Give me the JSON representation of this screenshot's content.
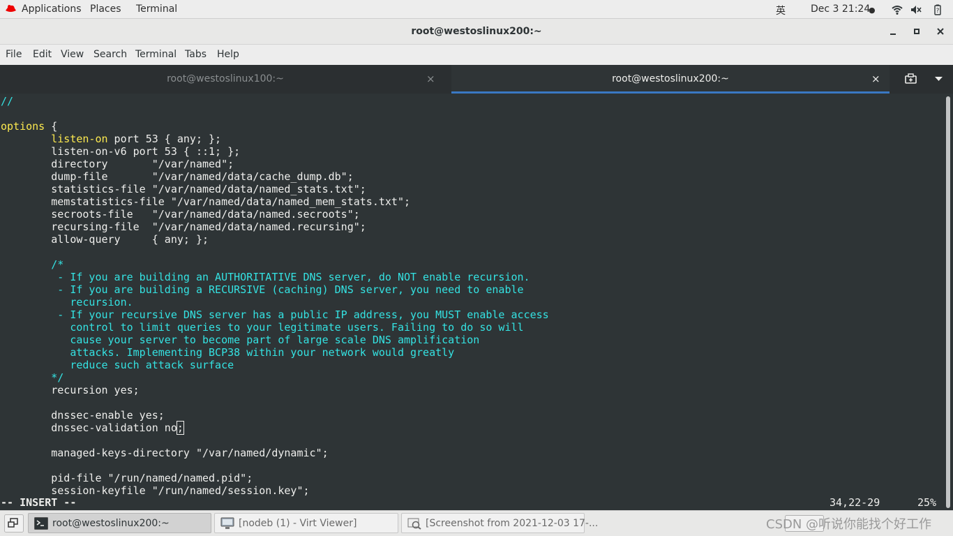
{
  "topbar": {
    "applications": "Applications",
    "places": "Places",
    "terminal": "Terminal",
    "ime": "英",
    "datetime": "Dec 3  21:24",
    "dot": "●"
  },
  "window": {
    "title": "root@westoslinux200:~"
  },
  "menu": {
    "file": "File",
    "edit": "Edit",
    "view": "View",
    "search": "Search",
    "terminal": "Terminal",
    "tabs": "Tabs",
    "help": "Help"
  },
  "tabs": [
    {
      "label": "root@westoslinux100:~",
      "close": "×"
    },
    {
      "label": "root@westoslinux200:~",
      "close": "×"
    }
  ],
  "terminal": {
    "lines": [
      {
        "segs": [
          {
            "t": "//",
            "c": "c"
          }
        ]
      },
      {
        "segs": []
      },
      {
        "segs": [
          {
            "t": "options",
            "c": "y"
          },
          {
            "t": " {"
          }
        ]
      },
      {
        "segs": [
          {
            "t": "        "
          },
          {
            "t": "listen-on",
            "c": "y"
          },
          {
            "t": " port 53 { any; };"
          }
        ]
      },
      {
        "segs": [
          {
            "t": "        listen-on-v6 port 53 { ::1; };"
          }
        ]
      },
      {
        "segs": [
          {
            "t": "        directory       \"/var/named\";"
          }
        ]
      },
      {
        "segs": [
          {
            "t": "        dump-file       \"/var/named/data/cache_dump.db\";"
          }
        ]
      },
      {
        "segs": [
          {
            "t": "        statistics-file \"/var/named/data/named_stats.txt\";"
          }
        ]
      },
      {
        "segs": [
          {
            "t": "        memstatistics-file \"/var/named/data/named_mem_stats.txt\";"
          }
        ]
      },
      {
        "segs": [
          {
            "t": "        secroots-file   \"/var/named/data/named.secroots\";"
          }
        ]
      },
      {
        "segs": [
          {
            "t": "        recursing-file  \"/var/named/data/named.recursing\";"
          }
        ]
      },
      {
        "segs": [
          {
            "t": "        allow-query     { any; };"
          }
        ]
      },
      {
        "segs": []
      },
      {
        "segs": [
          {
            "t": "        /*",
            "c": "c"
          }
        ]
      },
      {
        "segs": [
          {
            "t": "         - If you are building an AUTHORITATIVE DNS server, do NOT enable recursion.",
            "c": "c"
          }
        ]
      },
      {
        "segs": [
          {
            "t": "         - If you are building a RECURSIVE (caching) DNS server, you need to enable",
            "c": "c"
          }
        ]
      },
      {
        "segs": [
          {
            "t": "           recursion.",
            "c": "c"
          }
        ]
      },
      {
        "segs": [
          {
            "t": "         - If your recursive DNS server has a public IP address, you MUST enable access",
            "c": "c"
          }
        ]
      },
      {
        "segs": [
          {
            "t": "           control to limit queries to your legitimate users. Failing to do so will",
            "c": "c"
          }
        ]
      },
      {
        "segs": [
          {
            "t": "           cause your server to become part of large scale DNS amplification",
            "c": "c"
          }
        ]
      },
      {
        "segs": [
          {
            "t": "           attacks. Implementing BCP38 within your network would greatly",
            "c": "c"
          }
        ]
      },
      {
        "segs": [
          {
            "t": "           reduce such attack surface",
            "c": "c"
          }
        ]
      },
      {
        "segs": [
          {
            "t": "        */",
            "c": "c"
          }
        ]
      },
      {
        "segs": [
          {
            "t": "        recursion yes;"
          }
        ]
      },
      {
        "segs": []
      },
      {
        "segs": [
          {
            "t": "        dnssec-enable yes;"
          }
        ]
      },
      {
        "segs": [
          {
            "t": "        dnssec-validation no"
          },
          {
            "t": ";",
            "c": "cursor"
          }
        ]
      },
      {
        "segs": []
      },
      {
        "segs": [
          {
            "t": "        managed-keys-directory \"/var/named/dynamic\";"
          }
        ]
      },
      {
        "segs": []
      },
      {
        "segs": [
          {
            "t": "        pid-file \"/run/named/named.pid\";"
          }
        ]
      },
      {
        "segs": [
          {
            "t": "        session-keyfile \"/run/named/session.key\";"
          }
        ]
      }
    ],
    "mode": "-- INSERT --",
    "position": "34,22-29",
    "percent": "25%"
  },
  "taskbar": {
    "items": [
      {
        "label": "root@westoslinux200:~"
      },
      {
        "label": "[nodeb (1) - Virt Viewer]"
      },
      {
        "label": "[Screenshot from 2021-12-03 17-..."
      }
    ]
  },
  "watermark": "CSDN @听说你能找个好工作"
}
